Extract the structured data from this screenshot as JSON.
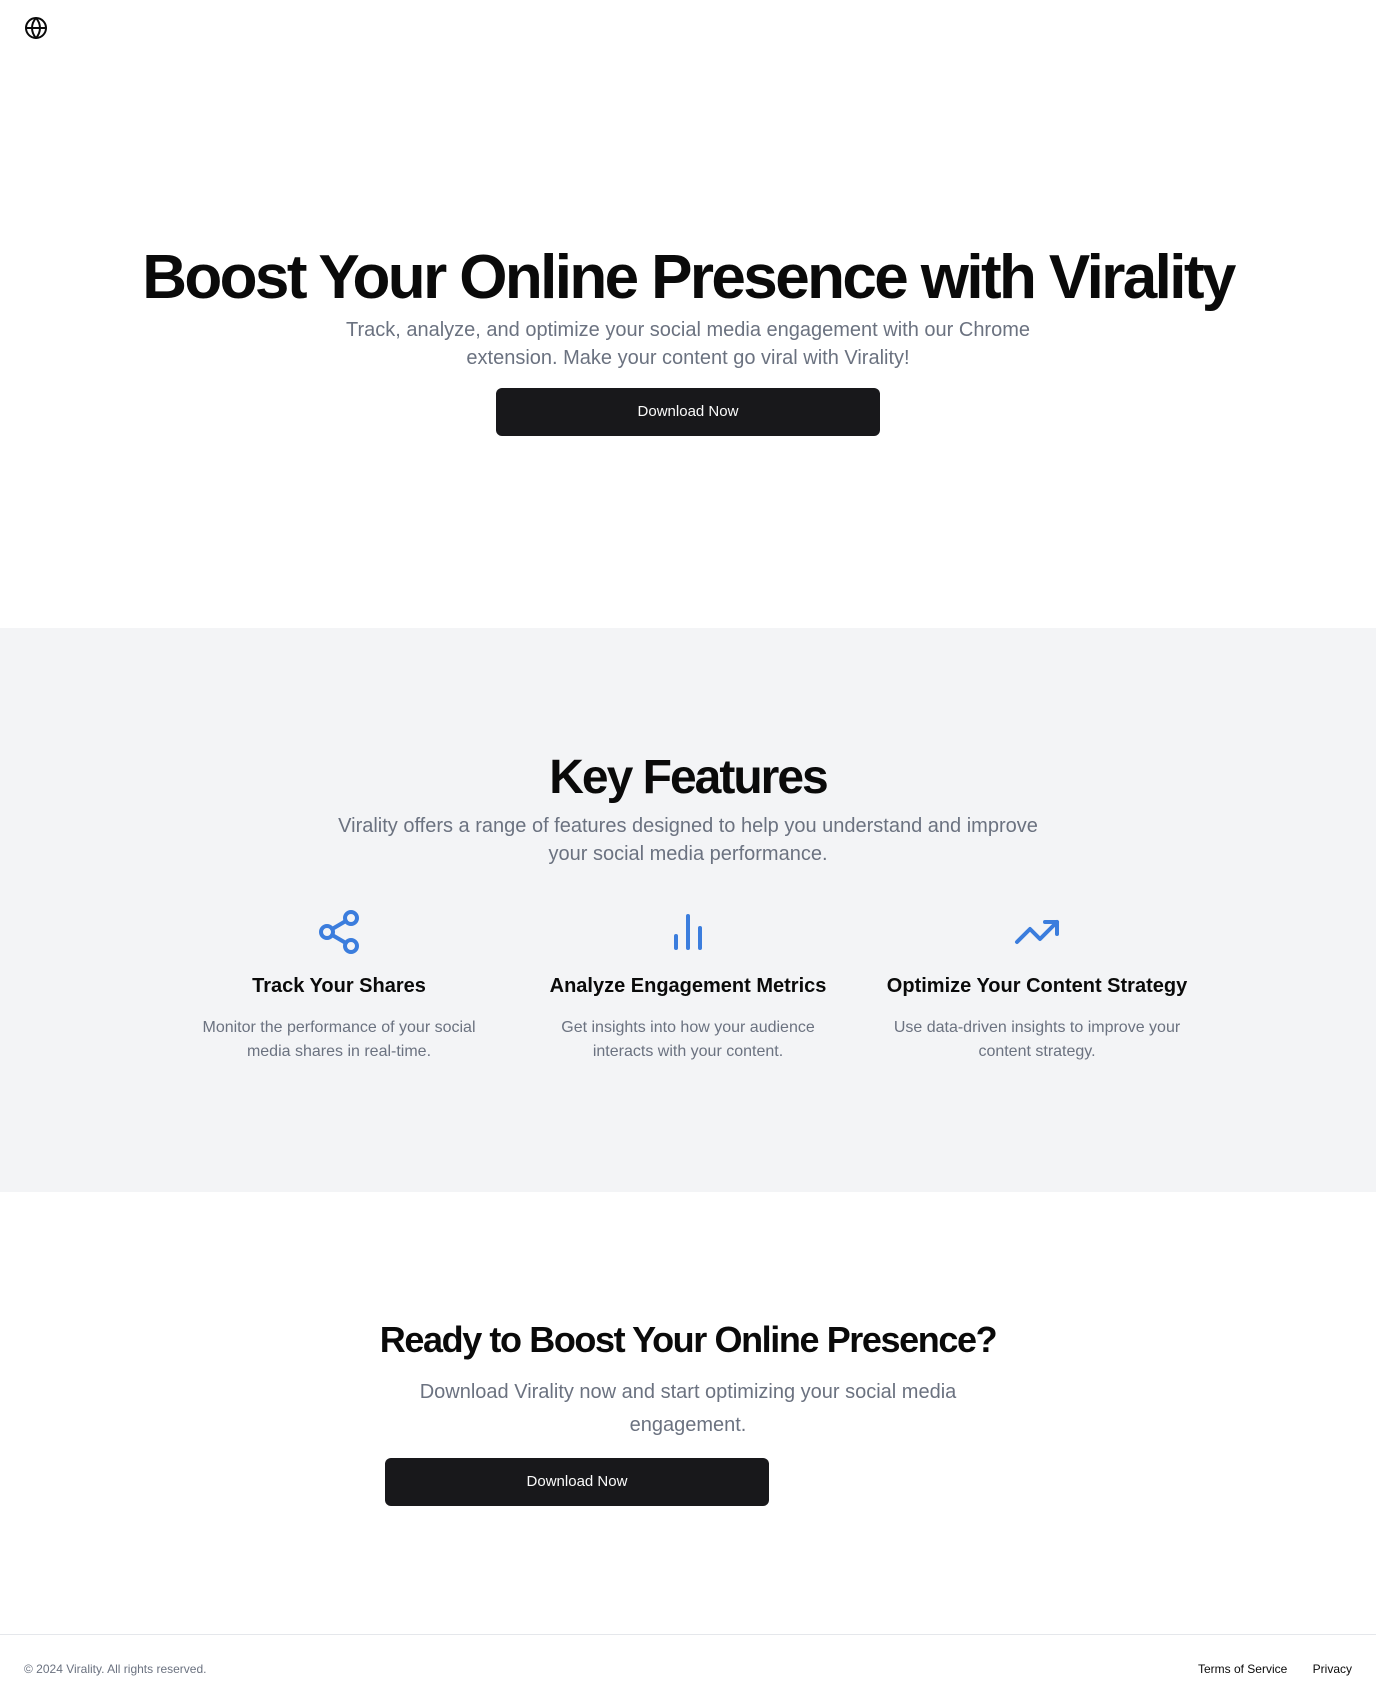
{
  "header": {
    "logo_icon": "globe-icon"
  },
  "hero": {
    "title": "Boost Your Online Presence with Virality",
    "subtitle": "Track, analyze, and optimize your social media engagement with our Chrome extension. Make your content go viral with Virality!",
    "button_label": "Download Now"
  },
  "features": {
    "title": "Key Features",
    "subtitle": "Virality offers a range of features designed to help you understand and improve your social media performance.",
    "accent_color": "#3b7ddd",
    "items": [
      {
        "icon": "share-icon",
        "title": "Track Your Shares",
        "description": "Monitor the performance of your social media shares in real-time."
      },
      {
        "icon": "bar-chart-icon",
        "title": "Analyze Engagement Metrics",
        "description": "Get insights into how your audience interacts with your content."
      },
      {
        "icon": "trending-up-icon",
        "title": "Optimize Your Content Strategy",
        "description": "Use data-driven insights to improve your content strategy."
      }
    ]
  },
  "cta": {
    "title": "Ready to Boost Your Online Presence?",
    "subtitle": "Download Virality now and start optimizing your social media engagement.",
    "button_label": "Download Now"
  },
  "footer": {
    "copyright": "© 2024 Virality. All rights reserved.",
    "links": [
      "Terms of Service",
      "Privacy"
    ]
  }
}
